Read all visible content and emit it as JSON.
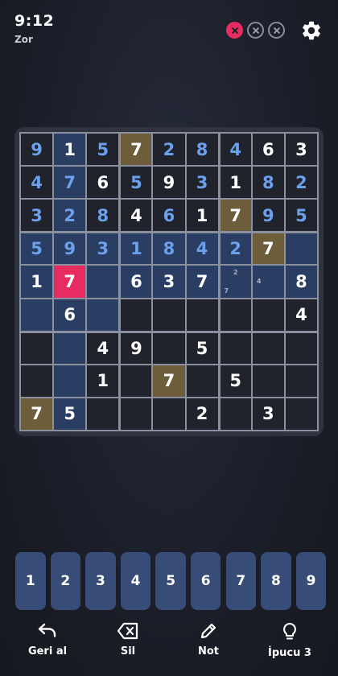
{
  "header": {
    "time": "9:12",
    "difficulty": "Zor",
    "mistakes": [
      true,
      false,
      false
    ]
  },
  "board": {
    "rows": [
      [
        "9",
        "1",
        "5",
        "7",
        "2",
        "8",
        "4",
        "6",
        "3"
      ],
      [
        "4",
        "7",
        "6",
        "5",
        "9",
        "3",
        "1",
        "8",
        "2"
      ],
      [
        "3",
        "2",
        "8",
        "4",
        "6",
        "1",
        "7",
        "9",
        "5"
      ],
      [
        "5",
        "9",
        "3",
        "1",
        "8",
        "4",
        "2",
        "7",
        ""
      ],
      [
        "1",
        "7",
        "",
        "6",
        "3",
        "7",
        "",
        "",
        "8"
      ],
      [
        "",
        "6",
        "",
        "",
        "",
        "",
        "",
        "",
        "4"
      ],
      [
        "",
        "",
        "4",
        "9",
        "",
        "5",
        "",
        "",
        ""
      ],
      [
        "",
        "",
        "1",
        "",
        "7",
        "",
        "5",
        "",
        ""
      ],
      [
        "7",
        "5",
        "",
        "",
        "",
        "2",
        "",
        "3",
        ""
      ]
    ],
    "user_entries": [
      [
        0,
        0
      ],
      [
        0,
        2
      ],
      [
        0,
        4
      ],
      [
        0,
        5
      ],
      [
        0,
        6
      ],
      [
        1,
        0
      ],
      [
        1,
        1
      ],
      [
        1,
        3
      ],
      [
        1,
        5
      ],
      [
        1,
        7
      ],
      [
        1,
        8
      ],
      [
        2,
        0
      ],
      [
        2,
        1
      ],
      [
        2,
        2
      ],
      [
        2,
        4
      ],
      [
        2,
        7
      ],
      [
        2,
        8
      ],
      [
        3,
        0
      ],
      [
        3,
        1
      ],
      [
        3,
        2
      ],
      [
        3,
        3
      ],
      [
        3,
        4
      ],
      [
        3,
        5
      ],
      [
        3,
        6
      ]
    ],
    "selected": [
      4,
      1
    ],
    "same_number": [
      [
        0,
        3
      ],
      [
        2,
        6
      ],
      [
        3,
        7
      ],
      [
        7,
        4
      ],
      [
        8,
        0
      ]
    ],
    "highlighted": [
      [
        3,
        0
      ],
      [
        3,
        1
      ],
      [
        3,
        2
      ],
      [
        3,
        3
      ],
      [
        3,
        4
      ],
      [
        3,
        5
      ],
      [
        3,
        6
      ],
      [
        3,
        8
      ],
      [
        4,
        0
      ],
      [
        4,
        2
      ],
      [
        4,
        3
      ],
      [
        4,
        4
      ],
      [
        4,
        5
      ],
      [
        4,
        6
      ],
      [
        4,
        7
      ],
      [
        4,
        8
      ],
      [
        5,
        0
      ],
      [
        5,
        1
      ],
      [
        5,
        2
      ],
      [
        0,
        1
      ],
      [
        1,
        1
      ],
      [
        2,
        1
      ],
      [
        6,
        1
      ],
      [
        7,
        1
      ],
      [
        8,
        1
      ]
    ],
    "notes": [
      {
        "row": 4,
        "col": 6,
        "values": [
          "",
          "2",
          "",
          "",
          "",
          "",
          "7",
          "",
          ""
        ]
      },
      {
        "row": 4,
        "col": 7,
        "values": [
          "",
          "",
          "",
          "4",
          "",
          "",
          "",
          "",
          ""
        ]
      }
    ]
  },
  "numpad": [
    "1",
    "2",
    "3",
    "4",
    "5",
    "6",
    "7",
    "8",
    "9"
  ],
  "toolbar": {
    "undo": {
      "label": "Geri al",
      "icon": "undo-icon"
    },
    "erase": {
      "label": "Sil",
      "icon": "erase-icon"
    },
    "notes": {
      "label": "Not",
      "icon": "pencil-icon"
    },
    "hint": {
      "label": "İpucu 3",
      "icon": "lightbulb-icon"
    }
  },
  "colors": {
    "background": "#1b1e28",
    "cell": "#20232c",
    "highlight": "#2a3d62",
    "same_number": "#6e5d3a",
    "selected": "#e62c61",
    "user_digit": "#6aa0ec",
    "given_digit": "#ffffff",
    "key": "#374c76"
  }
}
